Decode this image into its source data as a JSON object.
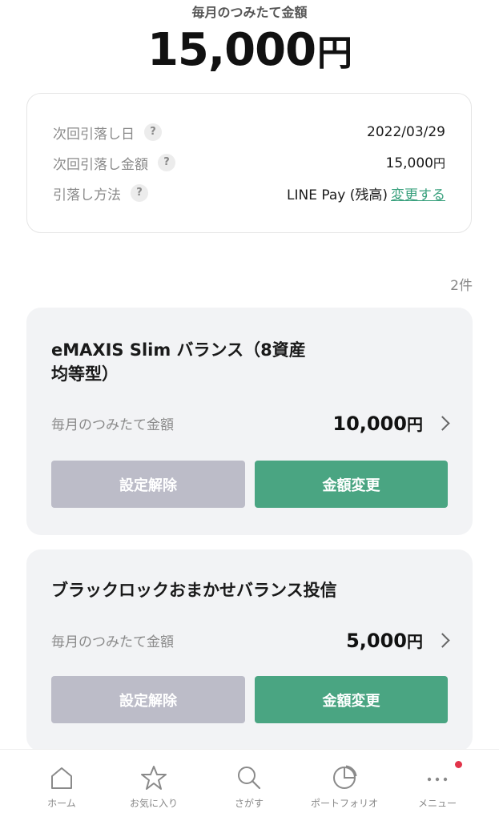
{
  "header": {
    "label": "毎月のつみたて金額",
    "total_amount": "15,000",
    "yen": "円"
  },
  "info": {
    "next_date_label": "次回引落し日",
    "next_date_value": "2022/03/29",
    "next_amount_label": "次回引落し金額",
    "next_amount_value": "15,000",
    "next_amount_yen": "円",
    "method_label": "引落し方法",
    "method_value": "LINE Pay (残高)",
    "change_link": "変更する",
    "help_icon": "?"
  },
  "count": "2件",
  "funds": [
    {
      "name_line1": "eMAXIS Slim バランス（8資産",
      "name_line2": "均等型）",
      "amount_label": "毎月のつみたて金額",
      "amount": "10,000",
      "yen": "円",
      "cancel_label": "設定解除",
      "change_label": "金額変更"
    },
    {
      "name_line1": "ブラックロックおまかせバランス投信",
      "amount_label": "毎月のつみたて金額",
      "amount": "5,000",
      "yen": "円",
      "cancel_label": "設定解除",
      "change_label": "金額変更"
    }
  ],
  "tabs": [
    {
      "label": "ホーム",
      "icon": "home-icon"
    },
    {
      "label": "お気に入り",
      "icon": "star-icon"
    },
    {
      "label": "さがす",
      "icon": "search-icon"
    },
    {
      "label": "ポートフォリオ",
      "icon": "pie-chart-icon"
    },
    {
      "label": "メニュー",
      "icon": "more-icon"
    }
  ],
  "colors": {
    "accent": "#4aa582",
    "link": "#3aa17e",
    "cancel_button": "#bcbcc8",
    "badge": "#e2344a"
  }
}
